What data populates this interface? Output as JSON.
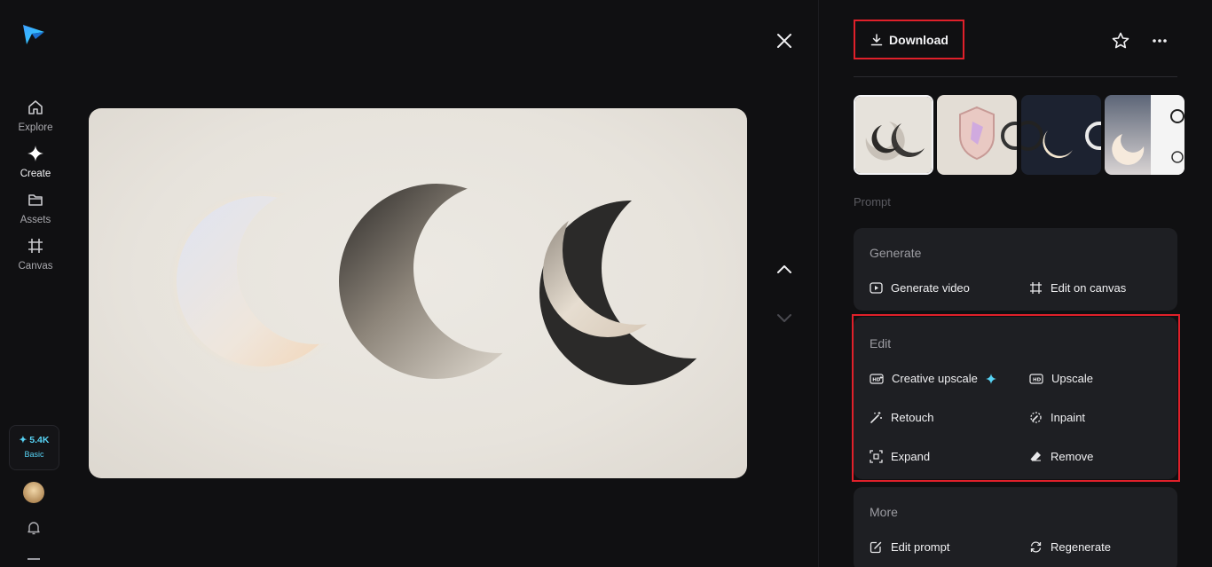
{
  "nav": {
    "items": [
      {
        "label": "Explore",
        "icon": "home-icon"
      },
      {
        "label": "Create",
        "icon": "sparkle-icon"
      },
      {
        "label": "Assets",
        "icon": "folder-icon"
      },
      {
        "label": "Canvas",
        "icon": "canvas-icon"
      }
    ],
    "credits": {
      "amount": "✦ 5.4K",
      "plan": "Basic"
    }
  },
  "toolbar": {
    "download_label": "Download"
  },
  "panel": {
    "prompt_label": "Prompt",
    "generate": {
      "title": "Generate",
      "actions": [
        {
          "label": "Generate video",
          "icon": "play-icon"
        },
        {
          "label": "Edit on canvas",
          "icon": "crop-icon"
        }
      ]
    },
    "edit": {
      "title": "Edit",
      "actions": [
        {
          "label": "Creative upscale",
          "icon": "hd-plus-icon"
        },
        {
          "label": "Upscale",
          "icon": "hd-icon"
        },
        {
          "label": "Retouch",
          "icon": "magic-wand-icon"
        },
        {
          "label": "Inpaint",
          "icon": "inpaint-icon"
        },
        {
          "label": "Expand",
          "icon": "expand-icon"
        },
        {
          "label": "Remove",
          "icon": "eraser-icon"
        }
      ]
    },
    "more": {
      "title": "More",
      "actions": [
        {
          "label": "Edit prompt",
          "icon": "edit-prompt-icon"
        },
        {
          "label": "Regenerate",
          "icon": "regenerate-icon"
        }
      ]
    }
  },
  "colors": {
    "accent": "#57d3f5",
    "highlight": "#e0202a",
    "panel": "#1e1f23",
    "background": "#101012"
  }
}
